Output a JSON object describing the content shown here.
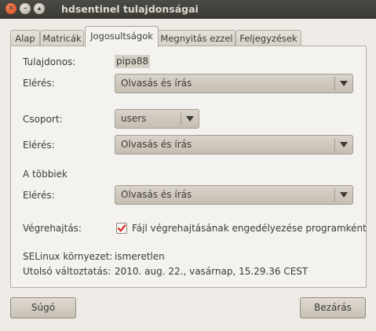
{
  "window": {
    "title": "hdsentinel tulajdonságai",
    "close_glyph": "✕",
    "min_glyph": "–",
    "max_glyph": "▴"
  },
  "tabs": [
    {
      "label": "Alap"
    },
    {
      "label": "Matricák"
    },
    {
      "label": "Jogosultságok",
      "active": true
    },
    {
      "label": "Megnyitás ezzel"
    },
    {
      "label": "Feljegyzések"
    }
  ],
  "permissions": {
    "owner_label": "Tulajdonos:",
    "owner_value": "pipa88",
    "owner_access_label": "Elérés:",
    "owner_access_value": "Olvasás és írás",
    "group_label": "Csoport:",
    "group_value": "users",
    "group_access_label": "Elérés:",
    "group_access_value": "Olvasás és írás",
    "others_label": "A többiek",
    "others_access_label": "Elérés:",
    "others_access_value": "Olvasás és írás",
    "execute_label": "Végrehajtás:",
    "execute_checkbox_label": "Fájl végrehajtásának engedélyezése programként",
    "execute_checked": true,
    "selinux_label": "SELinux környezet:",
    "selinux_value": "ismeretlen",
    "modified_label": "Utolsó változtatás:",
    "modified_value": "2010. aug. 22., vasárnap, 15.29.36 CEST"
  },
  "buttons": {
    "help": "Súgó",
    "close": "Bezárás"
  },
  "icons": {
    "combo_arrow": "chevron-down-icon",
    "check": "checkmark-icon"
  },
  "colors": {
    "titlebar": "#3c3b37",
    "window_bg": "#efebe7",
    "close_button": "#e2561f",
    "checkbox_mark": "#d0251e"
  }
}
